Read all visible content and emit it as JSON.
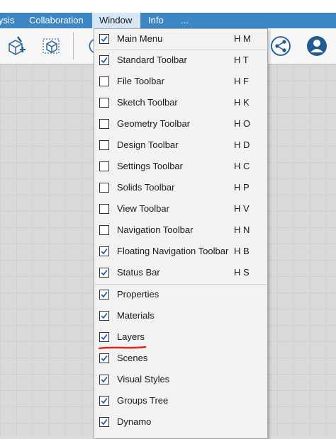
{
  "menubar": {
    "items": [
      {
        "label": "ysis"
      },
      {
        "label": "Collaboration"
      },
      {
        "label": "Window"
      },
      {
        "label": "Info"
      },
      {
        "label": "..."
      }
    ]
  },
  "toolbar": {
    "icons": [
      "new-sketch-icon",
      "box-select-icon",
      "view-icon",
      "share-icon",
      "account-icon"
    ]
  },
  "window_menu": {
    "items": [
      {
        "label": "Main Menu",
        "shortcut": "H M",
        "checked": true
      },
      {
        "label": "Standard Toolbar",
        "shortcut": "H T",
        "checked": true
      },
      {
        "label": "File Toolbar",
        "shortcut": "H F",
        "checked": false
      },
      {
        "label": "Sketch Toolbar",
        "shortcut": "H K",
        "checked": false
      },
      {
        "label": "Geometry Toolbar",
        "shortcut": "H O",
        "checked": false
      },
      {
        "label": "Design Toolbar",
        "shortcut": "H D",
        "checked": false
      },
      {
        "label": "Settings Toolbar",
        "shortcut": "H C",
        "checked": false
      },
      {
        "label": "Solids Toolbar",
        "shortcut": "H P",
        "checked": false
      },
      {
        "label": "View Toolbar",
        "shortcut": "H V",
        "checked": false
      },
      {
        "label": "Navigation Toolbar",
        "shortcut": "H N",
        "checked": false
      },
      {
        "label": "Floating Navigation Toolbar",
        "shortcut": "H B",
        "checked": true
      },
      {
        "label": "Status Bar",
        "shortcut": "H S",
        "checked": true
      },
      {
        "label": "Properties",
        "shortcut": "",
        "checked": true
      },
      {
        "label": "Materials",
        "shortcut": "",
        "checked": true
      },
      {
        "label": "Layers",
        "shortcut": "",
        "checked": true
      },
      {
        "label": "Scenes",
        "shortcut": "",
        "checked": true
      },
      {
        "label": "Visual Styles",
        "shortcut": "",
        "checked": true
      },
      {
        "label": "Groups Tree",
        "shortcut": "",
        "checked": true
      },
      {
        "label": "Dynamo",
        "shortcut": "",
        "checked": true
      }
    ]
  },
  "colors": {
    "menubar_bg": "#3d87c4",
    "active_menu_bg": "#d6e6f4",
    "check_color": "#1a62b5",
    "annotation_red": "#e0261d"
  }
}
